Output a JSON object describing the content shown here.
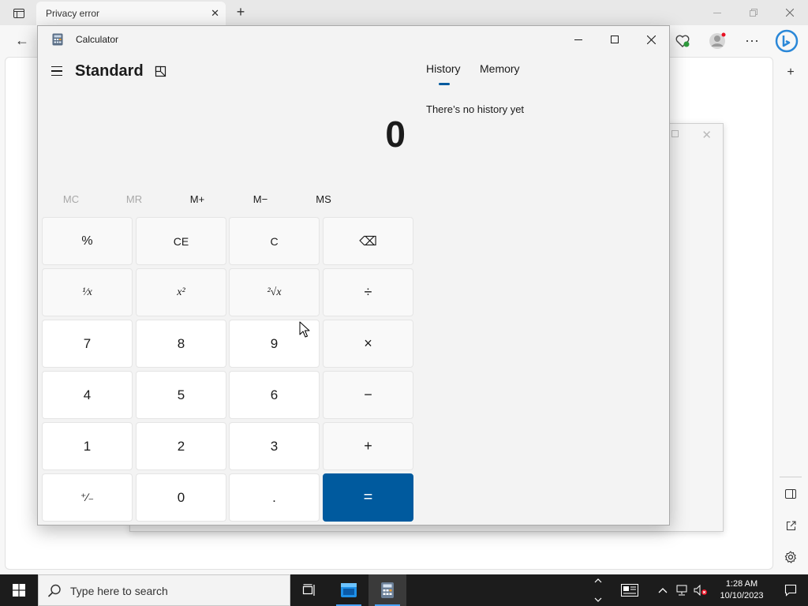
{
  "browser": {
    "tab_title": "Privacy error",
    "tab_close_glyph": "✕",
    "new_tab_glyph": "+",
    "back_glyph": "←",
    "more_glyph": "⋯",
    "sidebar_add_glyph": "+"
  },
  "ghost_window": {
    "close_glyph": "✕"
  },
  "calculator": {
    "window_title": "Calculator",
    "mode_title": "Standard",
    "display_value": "0",
    "memory_buttons": [
      {
        "label": "MC",
        "enabled": false
      },
      {
        "label": "MR",
        "enabled": false
      },
      {
        "label": "M+",
        "enabled": true
      },
      {
        "label": "M−",
        "enabled": true
      },
      {
        "label": "MS",
        "enabled": true
      }
    ],
    "keys": {
      "percent": "%",
      "clear_entry": "CE",
      "clear": "C",
      "backspace": "⌫",
      "reciprocal": "¹⁄x",
      "square": "x²",
      "square_root": "²√x",
      "divide": "÷",
      "seven": "7",
      "eight": "8",
      "nine": "9",
      "multiply": "×",
      "four": "4",
      "five": "5",
      "six": "6",
      "minus": "−",
      "one": "1",
      "two": "2",
      "three": "3",
      "plus": "+",
      "negate": "⁺∕₋",
      "zero": "0",
      "decimal": ".",
      "equals": "="
    },
    "history_tab": "History",
    "memory_tab": "Memory",
    "no_history_text": "There’s no history yet"
  },
  "taskbar": {
    "search_placeholder": "Type here to search",
    "time": "1:28 AM",
    "date": "10/10/2023",
    "accent": "#4aa3ff"
  },
  "colors": {
    "equals_button": "#005a9e",
    "calc_background": "#f3f3f3",
    "taskbar": "#1c1c1c"
  }
}
